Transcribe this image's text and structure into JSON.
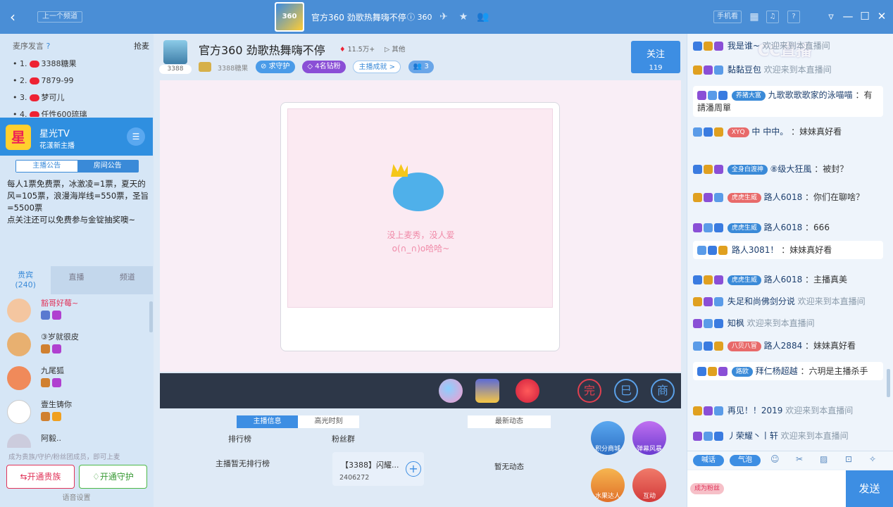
{
  "titlebar": {
    "prev_channel": "上一个频道",
    "title": "官方360 劲歌热舞嗨不停",
    "room_id": "360",
    "mobile": "手机看",
    "logo_text": "360"
  },
  "left": {
    "rank_title": "麦序发言",
    "grab": "抢麦",
    "ranks": [
      {
        "no": "1.",
        "name": "3388糖果"
      },
      {
        "no": "2.",
        "name": "7879-99"
      },
      {
        "no": "3.",
        "name": "梦可儿"
      },
      {
        "no": "4.",
        "name": "任性600琉璃"
      }
    ],
    "tv_name": "星光TV",
    "tv_sub": "花漾新主播",
    "tv_avatar": "星",
    "notice_tabs": [
      "主播公告",
      "房间公告"
    ],
    "notice_text": "每人1票免费票，冰激凌=1票，夏天的风=105票，浪漫海岸线=550票，圣旨=5500票\n点关注还可以免费参与金锭抽奖噢~",
    "tabs": [
      {
        "label": "贵宾",
        "count": "(240)"
      },
      {
        "label": "直播"
      },
      {
        "label": "频道"
      }
    ],
    "fans": [
      {
        "name": "豁哥好莓~",
        "color": "#e0345a"
      },
      {
        "name": "③岁就很皮",
        "color": "#333"
      },
      {
        "name": "九尾狐",
        "color": "#333"
      },
      {
        "name": "壹生铸你",
        "color": "#333"
      },
      {
        "name": "阿毅..",
        "color": "#333"
      }
    ],
    "hint": "成为贵族/守护/粉丝团成员，即可上麦",
    "open_noble": "开通贵族",
    "open_guard": "开通守护",
    "voice_settings": "语音设置"
  },
  "center": {
    "anchor_id": "3388",
    "room_title": "官方360 劲歌热舞嗨不停",
    "heat": "11.5万+",
    "other": "其他",
    "fan_group": "3388糖果",
    "badges": [
      "求守护",
      "4名钻粉",
      "主播成就 >",
      "3"
    ],
    "follow_label": "关注",
    "follow_count": "119",
    "empty_line1": "没上麦秀，没人爱",
    "empty_line2": "o(∩_∩)o哈哈~",
    "info_tabs": [
      "主播信息",
      "高光时刻"
    ],
    "rank_label": "排行榜",
    "fans_label": "粉丝群",
    "no_rank": "主播暂无排行榜",
    "group_name": "【3388】闪耀...",
    "group_id": "2406272",
    "news_label": "最新动态",
    "no_news": "暂无动态",
    "round_buttons": [
      "积分商城",
      "弹幕风暴",
      "水果达人",
      "互动"
    ],
    "gift_icons": [
      "balloon-icon",
      "box-icon",
      "firework-icon"
    ],
    "bar_icons": [
      "完",
      "巳",
      "商"
    ]
  },
  "right": {
    "watermark": "CC直播",
    "messages": [
      {
        "name": "我是谁~",
        "text": "欢迎来到本直播间",
        "welcome": true
      },
      {
        "name": "黏黏豆包",
        "text": "欢迎来到本直播间",
        "welcome": true
      },
      {
        "name": "九歌歌歌歌家的泳喵喵",
        "text": "：有請潘周單",
        "bubble": true,
        "tag": "养猪大富"
      },
      {
        "name": "中 中中。",
        "text": "：妹妹真好看",
        "tag": "XYQ"
      },
      {
        "name": "⑧级大狂風",
        "text": "：被封？",
        "tag": "全身白渡神"
      },
      {
        "name": "路人6018",
        "text": "：你们在聊啥？",
        "tag": "虎虎生威"
      },
      {
        "name": "路人6018",
        "text": "：666",
        "tag": "虎虎生威"
      },
      {
        "name": "路人3081！",
        "text": "：妹妹真好看",
        "bubble": true
      },
      {
        "name": "路人6018",
        "text": "：主播真美",
        "tag": "虎虎生威"
      },
      {
        "name": "失足和尚佛剑分说",
        "text": "欢迎来到本直播间",
        "welcome": true
      },
      {
        "name": "知枫",
        "text": "欢迎来到本直播间",
        "welcome": true
      },
      {
        "name": "路人2884",
        "text": "：妹妹真好看",
        "tag": "八贝八冒"
      },
      {
        "name": "拜仁杨超越",
        "text": "：六玥是主播杀手",
        "bubble": true,
        "tag": "路欧"
      },
      {
        "name": "再见！！2019",
        "text": "欢迎来到本直播间",
        "welcome": true
      },
      {
        "name": "丿荣耀丶丨轩",
        "text": "欢迎来到本直播间",
        "welcome": true
      }
    ],
    "chat_tabs": [
      "喊话",
      "气泡"
    ],
    "fan_btn": "成为粉丝",
    "send": "发送"
  }
}
